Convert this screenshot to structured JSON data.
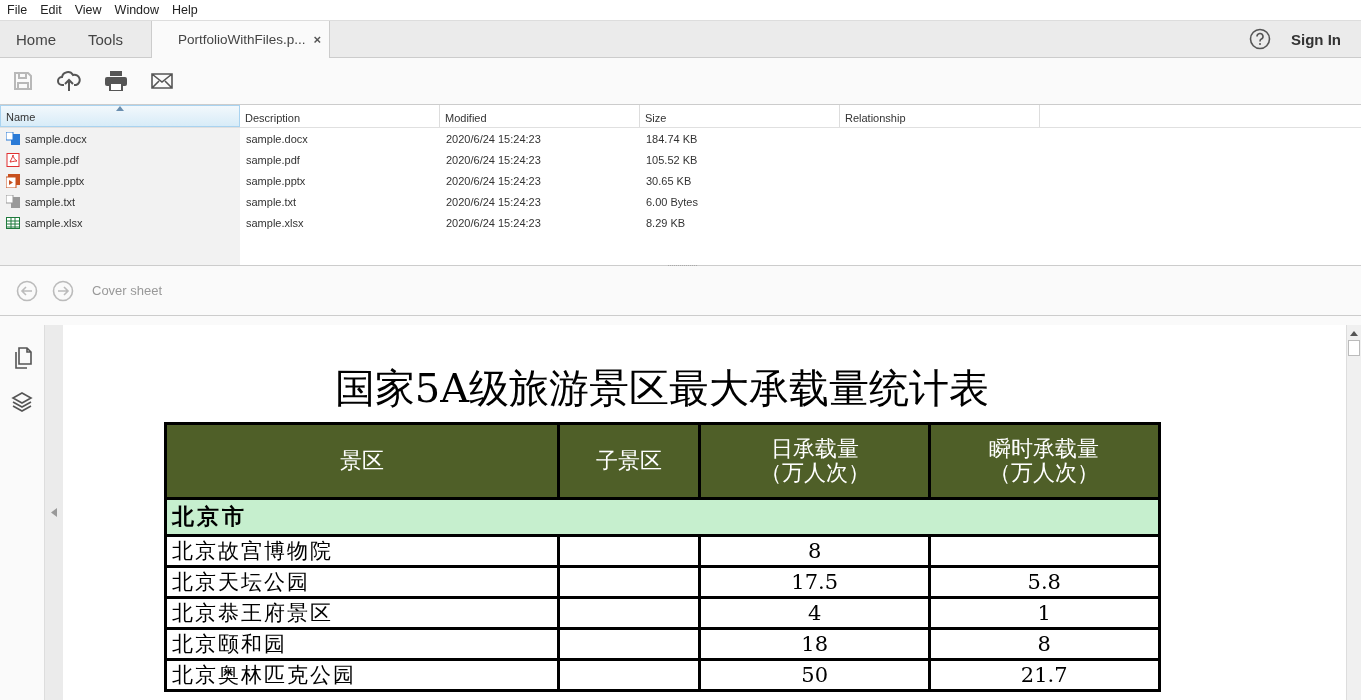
{
  "menu": [
    "File",
    "Edit",
    "View",
    "Window",
    "Help"
  ],
  "tabs": [
    {
      "label": "Home",
      "selected": false
    },
    {
      "label": "Tools",
      "selected": false
    },
    {
      "label": "PortfolioWithFiles.p...",
      "selected": true,
      "close": "×"
    }
  ],
  "account": {
    "sign_in": "Sign In"
  },
  "toolbar": [
    {
      "kind": "save",
      "disabled": true
    },
    {
      "kind": "upload",
      "disabled": false
    },
    {
      "kind": "print",
      "disabled": false
    },
    {
      "kind": "mail",
      "disabled": false
    }
  ],
  "file_table": {
    "columns": [
      {
        "label": "Name",
        "sorted": true
      },
      {
        "label": "Description",
        "sorted": false
      },
      {
        "label": "Modified",
        "sorted": false
      },
      {
        "label": "Size",
        "sorted": false
      },
      {
        "label": "Relationship",
        "sorted": false
      }
    ],
    "rows": [
      {
        "kind": "docx",
        "name": "sample.docx",
        "description": "sample.docx",
        "modified": "2020/6/24 15:24:23",
        "size": "184.74 KB"
      },
      {
        "kind": "pdf",
        "name": "sample.pdf",
        "description": "sample.pdf",
        "modified": "2020/6/24 15:24:23",
        "size": "105.52 KB"
      },
      {
        "kind": "pptx",
        "name": "sample.pptx",
        "description": "sample.pptx",
        "modified": "2020/6/24 15:24:23",
        "size": "30.65 KB"
      },
      {
        "kind": "txt",
        "name": "sample.txt",
        "description": "sample.txt",
        "modified": "2020/6/24 15:24:23",
        "size": "6.00 Bytes"
      },
      {
        "kind": "xlsx",
        "name": "sample.xlsx",
        "description": "sample.xlsx",
        "modified": "2020/6/24 15:24:23",
        "size": "8.29 KB"
      }
    ]
  },
  "navigation": {
    "label": "Cover sheet"
  },
  "document": {
    "title": "国家5A级旅游景区最大承载量统计表",
    "columns": [
      [
        "景区"
      ],
      [
        "子景区"
      ],
      [
        "日承载量",
        "（万人次）"
      ],
      [
        "瞬时承载量",
        "（万人次）"
      ]
    ],
    "sections": [
      {
        "name": "北京市",
        "rows": [
          {
            "cells": [
              "北京故宫博物院",
              "",
              "8",
              ""
            ]
          },
          {
            "cells": [
              "北京天坛公园",
              "",
              "17.5",
              "5.8"
            ]
          },
          {
            "cells": [
              "北京恭王府景区",
              "",
              "4",
              "1"
            ]
          },
          {
            "cells": [
              "北京颐和园",
              "",
              "18",
              "8"
            ]
          },
          {
            "cells": [
              "北京奥林匹克公园",
              "",
              "50",
              "21.7"
            ]
          }
        ]
      }
    ]
  }
}
